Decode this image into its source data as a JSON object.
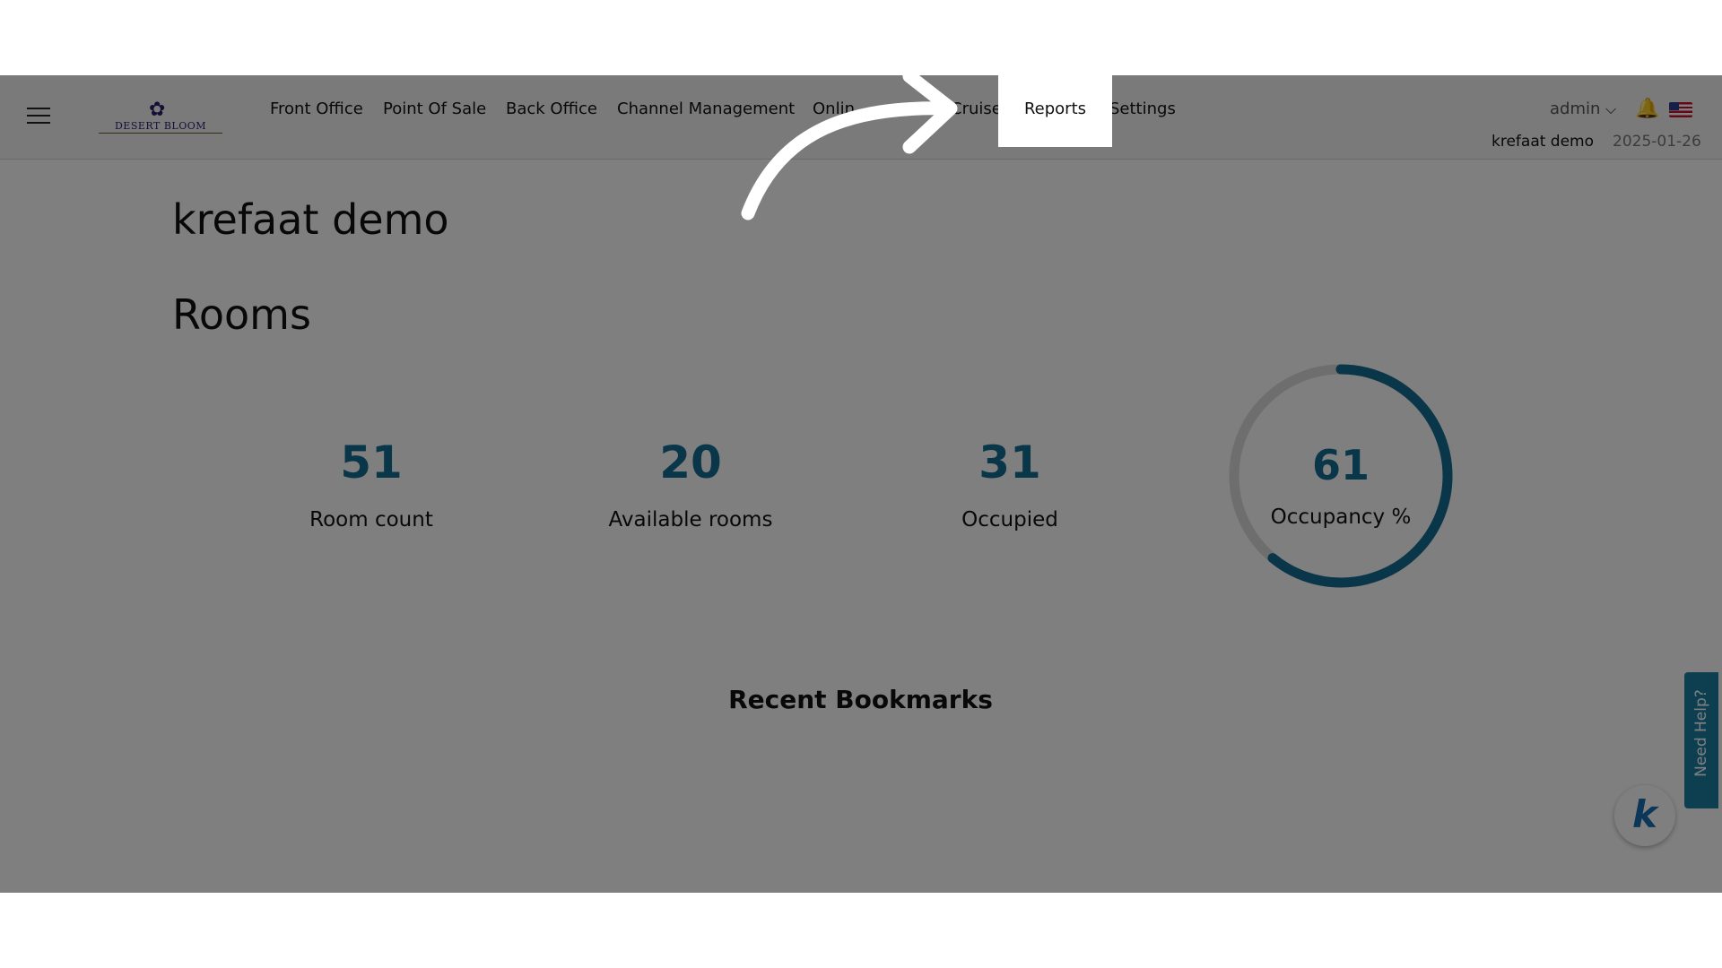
{
  "nav": {
    "menu": [
      {
        "label": "Front Office",
        "id": "front-office"
      },
      {
        "label": "Point Of Sale",
        "id": "point-of-sale"
      },
      {
        "label": "Back Office",
        "id": "back-office"
      },
      {
        "label": "Channel Management",
        "id": "channel-management"
      },
      {
        "label": "Onlin",
        "id": "online"
      },
      {
        "label": "Cruise",
        "id": "cruise"
      },
      {
        "label": "Reports",
        "id": "reports"
      },
      {
        "label": "Settings",
        "id": "settings"
      }
    ],
    "user": "admin",
    "org": "krefaat demo",
    "date": "2025-01-26",
    "logo_text": "DESERT BLOOM"
  },
  "page": {
    "org_title": "krefaat demo",
    "section_title": "Rooms"
  },
  "stats": [
    {
      "value": "51",
      "label": "Room count"
    },
    {
      "value": "20",
      "label": "Available rooms"
    },
    {
      "value": "31",
      "label": "Occupied"
    }
  ],
  "occupancy": {
    "value": "61",
    "label": "Occupancy %",
    "percent": 61
  },
  "bookmarks": {
    "title": "Recent Bookmarks"
  },
  "help": {
    "label": "Need Help?"
  },
  "chat": {
    "letter": "k"
  },
  "colors": {
    "accent": "#146c94",
    "help": "#1a7fa3",
    "track": "#dcdcdc"
  },
  "icons": {
    "menu": "hamburger-icon",
    "bell": "bell-icon",
    "flag": "us-flag-icon",
    "chevron": "chevron-down-icon"
  }
}
